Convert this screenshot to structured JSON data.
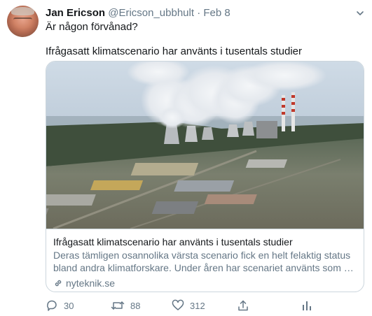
{
  "tweet": {
    "author_name": "Jan Ericson",
    "author_handle": "@Ericson_ubbhult",
    "separator": "·",
    "date": "Feb 8",
    "text_line1": "Är någon förvånad?",
    "text_line2": "Ifrågasatt klimatscenario har använts i tusentals studier"
  },
  "card": {
    "image_icon": "power-plant-photo",
    "title": "Ifrågasatt klimatscenario har använts i tusentals studier",
    "description": "Deras tämligen osannolika värsta scenario fick en helt felaktig status bland andra klimatforskare. Under åren har scenariet använts som …",
    "domain": "nyteknik.se",
    "domain_icon": "link-icon"
  },
  "actions": {
    "reply_count": "30",
    "retweet_count": "88",
    "like_count": "312",
    "reply_icon": "reply-icon",
    "retweet_icon": "retweet-icon",
    "like_icon": "heart-icon",
    "share_icon": "share-icon",
    "analytics_icon": "analytics-icon"
  },
  "colors": {
    "text_primary": "#14171a",
    "text_secondary": "#657786",
    "border": "#ccd6dd"
  }
}
